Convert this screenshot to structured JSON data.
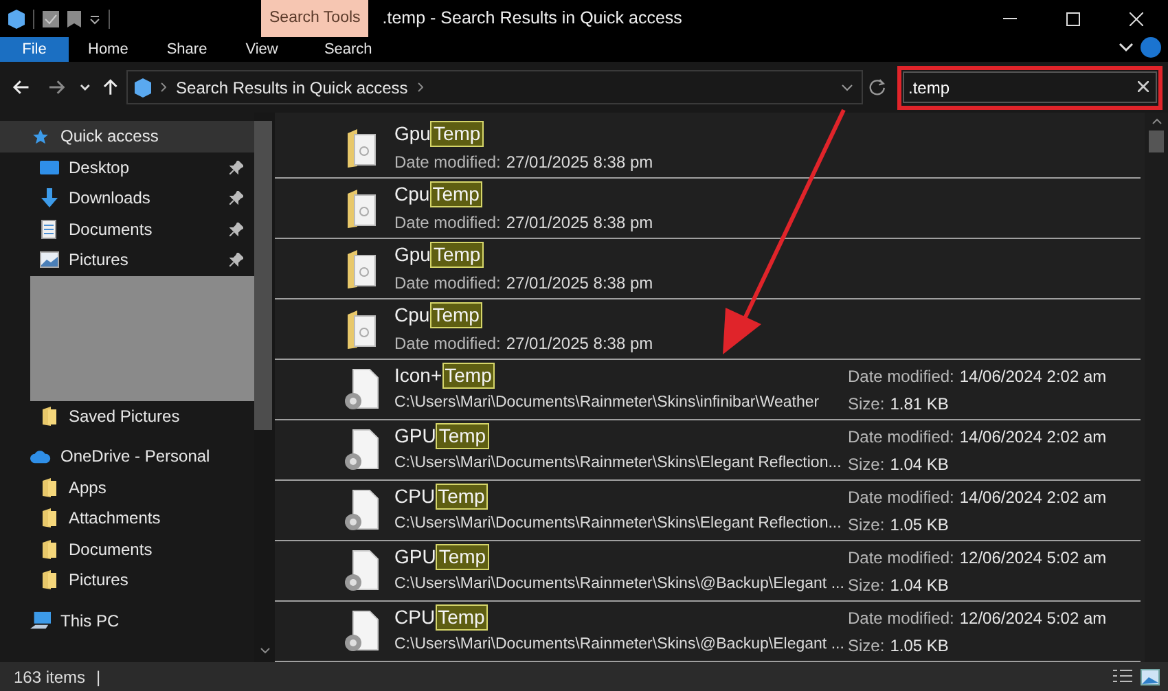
{
  "window": {
    "title": ".temp - Search Results in Quick access"
  },
  "contextual_tab": {
    "label": "Search Tools"
  },
  "ribbon_tabs": [
    {
      "label": "File",
      "kind": "file",
      "selected": false
    },
    {
      "label": "Home",
      "kind": "tab",
      "selected": false
    },
    {
      "label": "Share",
      "kind": "tab",
      "selected": false
    },
    {
      "label": "View",
      "kind": "tab",
      "selected": false
    },
    {
      "label": "Search",
      "kind": "tab",
      "selected": false
    }
  ],
  "address_bar": {
    "path": "Search Results in Quick access"
  },
  "search": {
    "value": ".temp"
  },
  "sidebar": {
    "items": [
      {
        "label": "Quick access",
        "kind": "star",
        "selected": true,
        "children": [
          {
            "label": "Desktop",
            "kind": "desktop",
            "pinned": true
          },
          {
            "label": "Downloads",
            "kind": "download",
            "pinned": true
          },
          {
            "label": "Documents",
            "kind": "document",
            "pinned": true
          },
          {
            "label": "Pictures",
            "kind": "picture",
            "pinned": true
          },
          {
            "kind": "redacted"
          },
          {
            "label": "Saved Pictures",
            "kind": "folder",
            "pinned": false
          }
        ]
      },
      {
        "label": "OneDrive - Personal",
        "kind": "cloud",
        "selected": false,
        "children": [
          {
            "label": "Apps",
            "kind": "folder",
            "pinned": false
          },
          {
            "label": "Attachments",
            "kind": "folder",
            "pinned": false
          },
          {
            "label": "Documents",
            "kind": "folder",
            "pinned": false
          },
          {
            "label": "Pictures",
            "kind": "folder",
            "pinned": false
          }
        ]
      },
      {
        "label": "This PC",
        "kind": "pc",
        "selected": false
      }
    ]
  },
  "results": [
    {
      "kind": "folder",
      "name": "Gpu",
      "match": "Temp",
      "date_label": "Date modified:",
      "date": "27/01/2025 8:38 pm"
    },
    {
      "kind": "folder",
      "name": "Cpu",
      "match": "Temp",
      "date_label": "Date modified:",
      "date": "27/01/2025 8:38 pm"
    },
    {
      "kind": "folder",
      "name": "Gpu",
      "match": "Temp",
      "date_label": "Date modified:",
      "date": "27/01/2025 8:38 pm"
    },
    {
      "kind": "folder",
      "name": "Cpu",
      "match": "Temp",
      "date_label": "Date modified:",
      "date": "27/01/2025 8:38 pm"
    },
    {
      "kind": "file",
      "name": "Icon+",
      "match": "Temp",
      "path": "C:\\Users\\Mari\\Documents\\Rainmeter\\Skins\\infinibar\\Weather",
      "date_label": "Date modified:",
      "date": "14/06/2024 2:02 am",
      "size_label": "Size:",
      "size": "1.81 KB"
    },
    {
      "kind": "file",
      "name": "GPU",
      "match": "Temp",
      "path": "C:\\Users\\Mari\\Documents\\Rainmeter\\Skins\\Elegant Reflection...",
      "date_label": "Date modified:",
      "date": "14/06/2024 2:02 am",
      "size_label": "Size:",
      "size": "1.04 KB"
    },
    {
      "kind": "file",
      "name": "CPU",
      "match": "Temp",
      "path": "C:\\Users\\Mari\\Documents\\Rainmeter\\Skins\\Elegant Reflection...",
      "date_label": "Date modified:",
      "date": "14/06/2024 2:02 am",
      "size_label": "Size:",
      "size": "1.05 KB"
    },
    {
      "kind": "file",
      "name": "GPU",
      "match": "Temp",
      "path": "C:\\Users\\Mari\\Documents\\Rainmeter\\Skins\\@Backup\\Elegant ...",
      "date_label": "Date modified:",
      "date": "12/06/2024 5:02 am",
      "size_label": "Size:",
      "size": "1.04 KB"
    },
    {
      "kind": "file",
      "name": "CPU",
      "match": "Temp",
      "path": "C:\\Users\\Mari\\Documents\\Rainmeter\\Skins\\@Backup\\Elegant ...",
      "date_label": "Date modified:",
      "date": "12/06/2024 5:02 am",
      "size_label": "Size:",
      "size": "1.05 KB"
    }
  ],
  "status_bar": {
    "count": "163 items",
    "separator": "|"
  }
}
